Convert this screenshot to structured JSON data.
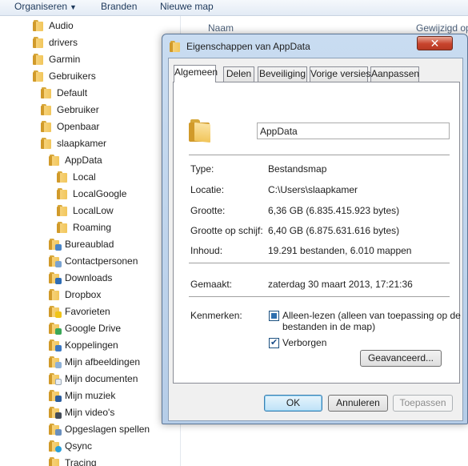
{
  "toolbar": {
    "organize": "Organiseren",
    "burn": "Branden",
    "new_folder": "Nieuwe map"
  },
  "tree": [
    {
      "label": "Audio"
    },
    {
      "label": "drivers"
    },
    {
      "label": "Garmin"
    },
    {
      "label": "Gebruikers"
    },
    {
      "label": "Default"
    },
    {
      "label": "Gebruiker"
    },
    {
      "label": "Openbaar"
    },
    {
      "label": "slaapkamer"
    },
    {
      "label": "AppData"
    },
    {
      "label": "Local"
    },
    {
      "label": "LocalGoogle"
    },
    {
      "label": "LocalLow"
    },
    {
      "label": "Roaming"
    },
    {
      "label": "Bureaublad"
    },
    {
      "label": "Contactpersonen"
    },
    {
      "label": "Downloads"
    },
    {
      "label": "Dropbox"
    },
    {
      "label": "Favorieten"
    },
    {
      "label": "Google Drive"
    },
    {
      "label": "Koppelingen"
    },
    {
      "label": "Mijn afbeeldingen"
    },
    {
      "label": "Mijn documenten"
    },
    {
      "label": "Mijn muziek"
    },
    {
      "label": "Mijn video's"
    },
    {
      "label": "Opgeslagen spellen"
    },
    {
      "label": "Qsync"
    },
    {
      "label": "Tracing"
    }
  ],
  "columns": {
    "name": "Naam",
    "modified": "Gewijzigd op"
  },
  "dialog": {
    "title": "Eigenschappen van AppData",
    "tabs": [
      "Algemeen",
      "Delen",
      "Beveiliging",
      "Vorige versies",
      "Aanpassen"
    ],
    "folder_name": "AppData",
    "type_label": "Type:",
    "type_value": "Bestandsmap",
    "location_label": "Locatie:",
    "location_value": "C:\\Users\\slaapkamer",
    "size_label": "Grootte:",
    "size_value": "6,36 GB (6.835.415.923 bytes)",
    "size_on_disk_label": "Grootte op schijf:",
    "size_on_disk_value": "6,40 GB (6.875.631.616 bytes)",
    "contents_label": "Inhoud:",
    "contents_value": "19.291 bestanden, 6.010 mappen",
    "created_label": "Gemaakt:",
    "created_value": "zaterdag 30 maart 2013, 17:21:36",
    "attributes_label": "Kenmerken:",
    "readonly_label": "Alleen-lezen (alleen van toepassing op de bestanden in de map)",
    "hidden_label": "Verborgen",
    "advanced_button": "Geavanceerd...",
    "ok_button": "OK",
    "cancel_button": "Annuleren",
    "apply_button": "Toepassen"
  }
}
